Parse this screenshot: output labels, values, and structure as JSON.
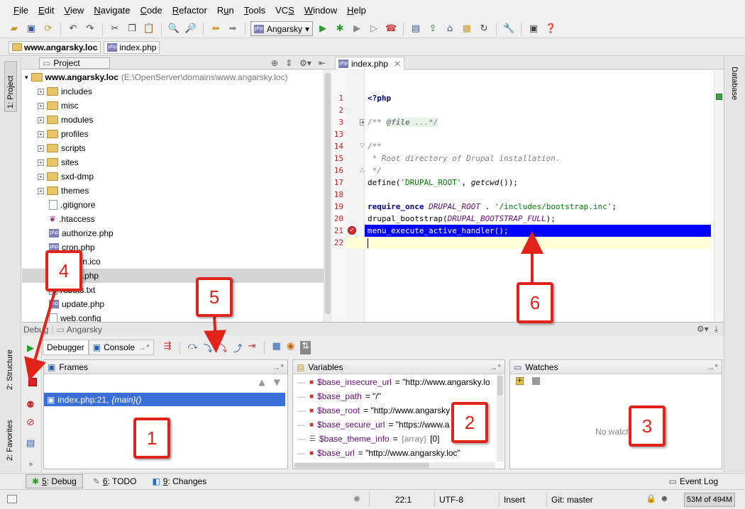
{
  "menu": [
    "File",
    "Edit",
    "View",
    "Navigate",
    "Code",
    "Refactor",
    "Run",
    "Tools",
    "VCS",
    "Window",
    "Help"
  ],
  "toolbar": {
    "run_config": "Angarsky"
  },
  "breadcrumb": {
    "project": "www.angarsky.loc",
    "file": "index.php"
  },
  "left_stripe": {
    "project": "1: Project",
    "structure": "2: Structure",
    "favorites": "2: Favorites"
  },
  "right_stripe": {
    "database": "Database"
  },
  "project_panel": {
    "selector": "Project",
    "root_name": "www.angarsky.loc",
    "root_path": "(E:\\OpenServer\\domains\\www.angarsky.loc)",
    "folders": [
      "includes",
      "misc",
      "modules",
      "profiles",
      "scripts",
      "sites",
      "sxd-dmp",
      "themes"
    ],
    "files": [
      ".gitignore",
      ".htaccess",
      "authorize.php",
      "cron.php",
      "favicon.ico",
      "index.php",
      "robots.txt",
      "update.php",
      "web.config"
    ],
    "selected_file": "index.php"
  },
  "editor": {
    "tab": "index.php",
    "lines": [
      {
        "n": "1",
        "code": "<?php"
      },
      {
        "n": "2",
        "code": ""
      },
      {
        "n": "3",
        "code": "/** @file ...*/"
      },
      {
        "n": "13",
        "code": ""
      },
      {
        "n": "14",
        "code": "/**"
      },
      {
        "n": "15",
        "code": " * Root directory of Drupal installation."
      },
      {
        "n": "16",
        "code": " */"
      },
      {
        "n": "17",
        "code": "define('DRUPAL_ROOT', getcwd());"
      },
      {
        "n": "18",
        "code": ""
      },
      {
        "n": "19",
        "code": "require_once DRUPAL_ROOT . '/includes/bootstrap.inc';"
      },
      {
        "n": "20",
        "code": "drupal_bootstrap(DRUPAL_BOOTSTRAP_FULL);"
      },
      {
        "n": "21",
        "code": "menu_execute_active_handler();"
      },
      {
        "n": "22",
        "code": ""
      }
    ],
    "breakpoint_line": "21"
  },
  "debug": {
    "header_label": "Debug",
    "config": "Angarsky",
    "tab_debugger": "Debugger",
    "tab_console": "Console",
    "frames_title": "Frames",
    "frame": "index.php:21,",
    "frame_main": "{main}()",
    "variables_title": "Variables",
    "variables": [
      {
        "name": "$base_insecure_url",
        "value": " = \"http://www.angarsky.lo"
      },
      {
        "name": "$base_path",
        "value": " = \"/\""
      },
      {
        "name": "$base_root",
        "value": " = \"http://www.angarsky"
      },
      {
        "name": "$base_secure_url",
        "value": " = \"https://www.a"
      },
      {
        "name": "$base_theme_info",
        "value": " = {array} [0]"
      },
      {
        "name": "$base_url",
        "value": " = \"http://www.angarsky.loc\""
      }
    ],
    "watches_title": "Watches",
    "watches_empty": "No watche"
  },
  "bottom_tabs": [
    {
      "num": "5",
      "label": ": Debug"
    },
    {
      "num": "6",
      "label": ": TODO"
    },
    {
      "num": "9",
      "label": ": Changes"
    }
  ],
  "event_log": "Event Log",
  "status": {
    "position": "22:1",
    "encoding": "UTF-8",
    "mode": "Insert",
    "vcs": "Git: master",
    "memory": "53M of 494M"
  },
  "callouts": [
    "1",
    "2",
    "3",
    "4",
    "5",
    "6"
  ],
  "colors": {
    "callout": "#e2231a",
    "selection": "#0000ff",
    "current_line": "#ffffd7"
  }
}
